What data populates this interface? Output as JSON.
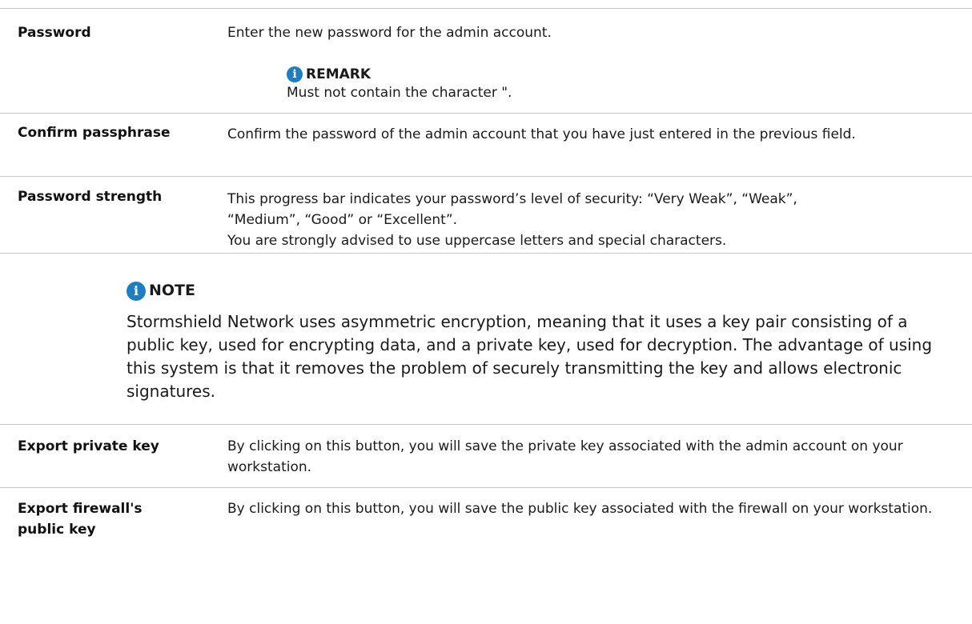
{
  "rows": [
    {
      "term": "Password",
      "definition": "Enter the new password for the admin account.",
      "remark_title": "REMARK",
      "remark_text": "Must not contain the character \"."
    },
    {
      "term": "Confirm passphrase",
      "definition": "Confirm the password of the admin account that you have just entered in the previous field."
    },
    {
      "term": "Password strength",
      "definition_line1": "This progress bar indicates your password’s level of security: “Very Weak”, “Weak”, “Medium”, “Good” or “Excellent”.",
      "definition_line2": "You are strongly advised to use uppercase letters and special characters."
    }
  ],
  "note": {
    "title": "NOTE",
    "text": "Stormshield Network uses asymmetric encryption, meaning that it uses a key pair consisting of a public key, used for encrypting data, and a private key, used for decryption. The advantage of using this system is that it removes the problem of securely transmitting the key and allows electronic signatures."
  },
  "rows2": [
    {
      "term": "Export private key",
      "definition": "By clicking on this button, you will save the private key associated with the admin account on your workstation."
    },
    {
      "term_line1": "Export firewall's",
      "term_line2": "public key",
      "definition": "By clicking on this button, you will save the public key associated with the firewall on your workstation."
    }
  ],
  "icons": {
    "info_glyph": "i",
    "icon_color": "#1f7ec0"
  }
}
